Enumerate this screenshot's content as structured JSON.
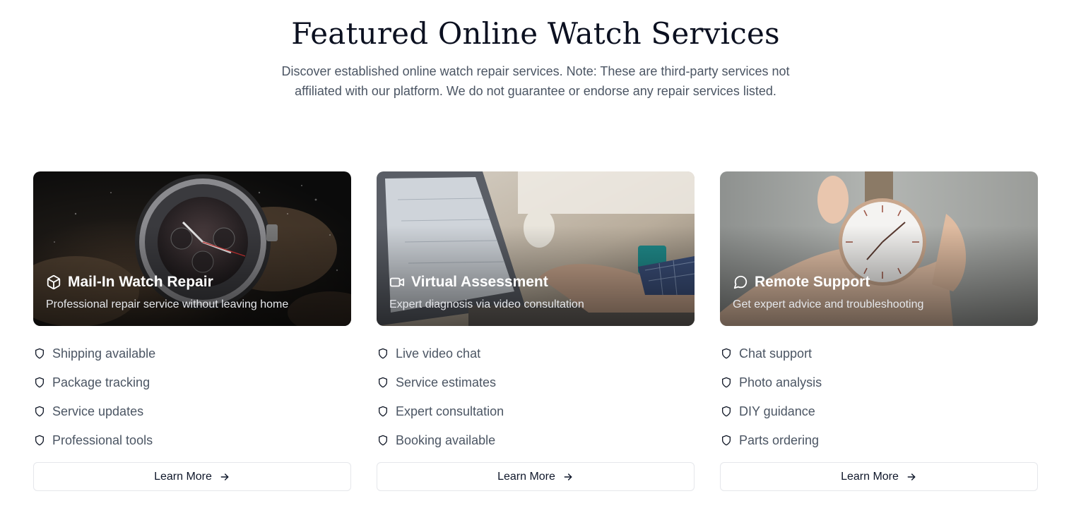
{
  "header": {
    "title": "Featured Online Watch Services",
    "description": "Discover established online watch repair services. Note: These are third-party services not affiliated with our platform. We do not guarantee or endorse any repair services listed."
  },
  "cards": [
    {
      "title": "Mail-In Watch Repair",
      "subtitle": "Professional repair service without leaving home",
      "icon": "package-icon",
      "features": [
        "Shipping available",
        "Package tracking",
        "Service updates",
        "Professional tools"
      ],
      "button_label": "Learn More"
    },
    {
      "title": "Virtual Assessment",
      "subtitle": "Expert diagnosis via video consultation",
      "icon": "video-icon",
      "features": [
        "Live video chat",
        "Service estimates",
        "Expert consultation",
        "Booking available"
      ],
      "button_label": "Learn More"
    },
    {
      "title": "Remote Support",
      "subtitle": "Get expert advice and troubleshooting",
      "icon": "message-circle-icon",
      "features": [
        "Chat support",
        "Photo analysis",
        "DIY guidance",
        "Parts ordering"
      ],
      "button_label": "Learn More"
    }
  ],
  "icons": {
    "feature_bullet": "shield-icon",
    "button_arrow": "arrow-right-icon"
  },
  "colors": {
    "heading": "#0b1020",
    "body_text": "#4b5563",
    "button_border": "#e5e7eb"
  }
}
